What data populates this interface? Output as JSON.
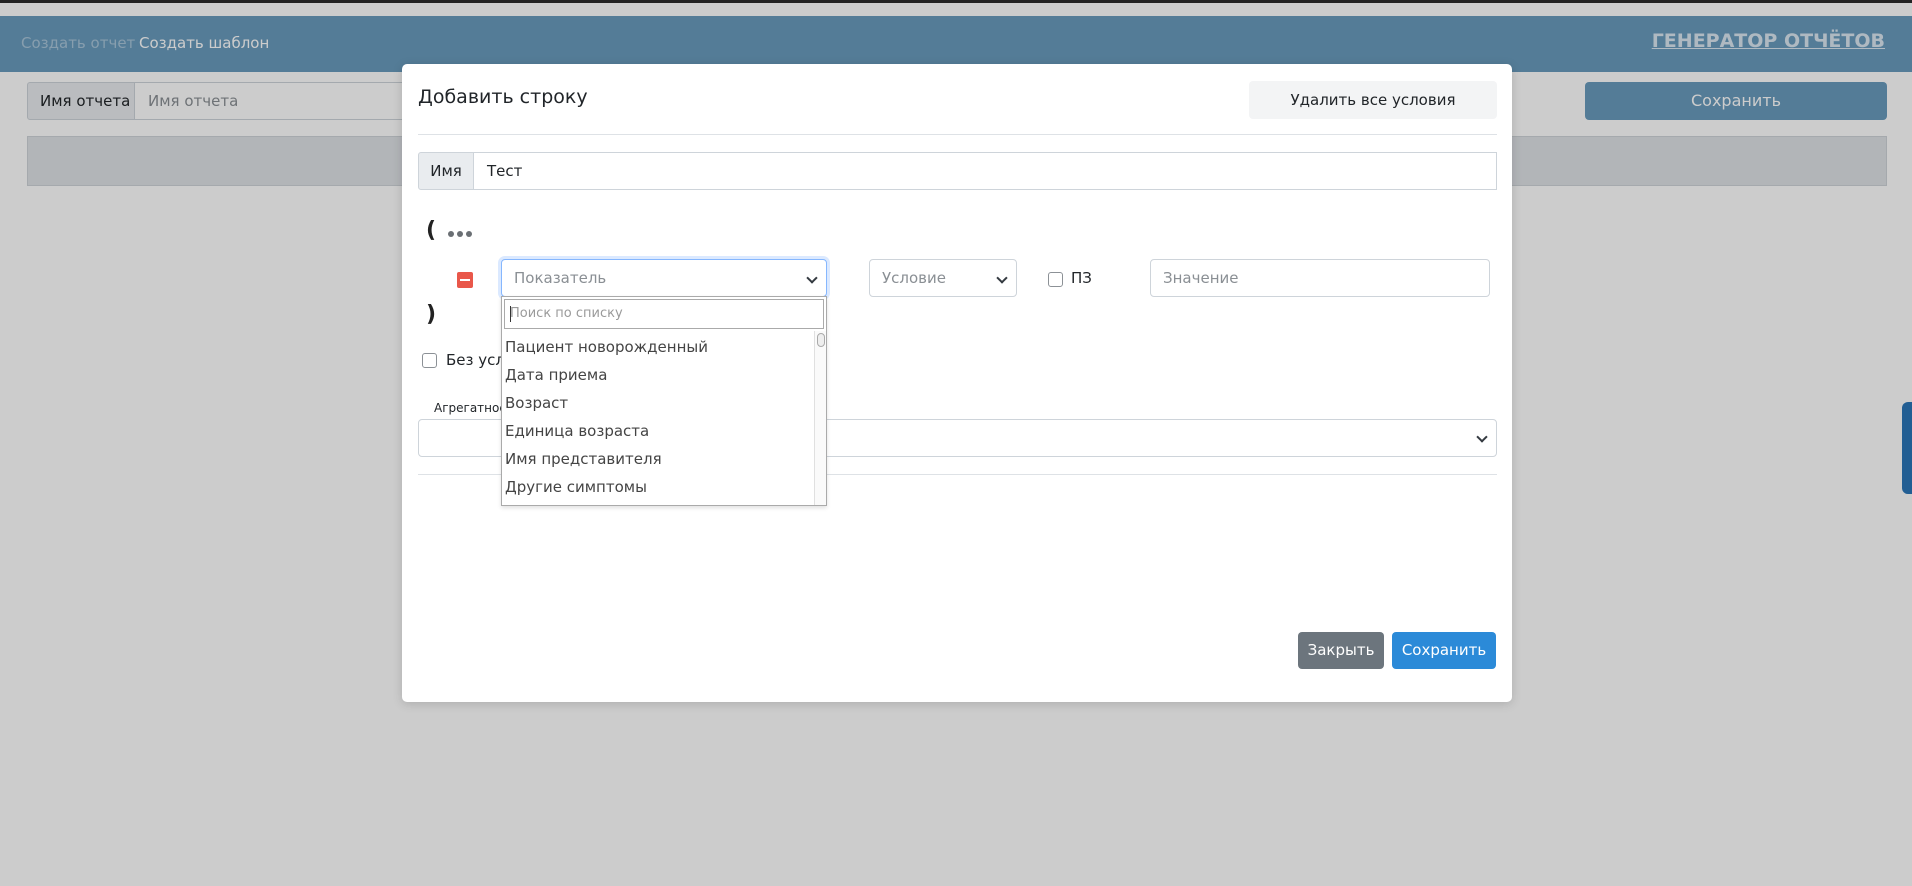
{
  "page": {
    "nav": {
      "create_report": "Создать отчет",
      "create_template": "Создать шаблон",
      "brand": "ГЕНЕРАТОР ОТЧЁТОВ"
    },
    "report_name_label": "Имя отчета",
    "report_name_placeholder": "Имя отчета",
    "save_label": "Сохранить"
  },
  "modal": {
    "title": "Добавить строку",
    "clear_conditions_label": "Удалить все условия",
    "name_label": "Имя",
    "name_value": "Тест",
    "open_paren": "(",
    "close_paren": ")",
    "condition_row": {
      "indicator_placeholder": "Показатель",
      "condition_placeholder": "Условие",
      "pz_label": "ПЗ",
      "value_placeholder": "Значение"
    },
    "no_conditions_label": "Без усло",
    "aggregate_label": "Агрегатное",
    "close_label": "Закрыть",
    "save_label": "Сохранить"
  },
  "dropdown": {
    "search_placeholder": "Поиск по списку",
    "items": [
      "Пациент новорожденный",
      "Дата приема",
      "Возраст",
      "Единица возраста",
      "Имя представителя",
      "Другие симптомы"
    ]
  },
  "colors": {
    "navbar": "#699bbd",
    "primary": "#2b8ad8",
    "secondary": "#6c757d",
    "danger": "#e9574a"
  }
}
